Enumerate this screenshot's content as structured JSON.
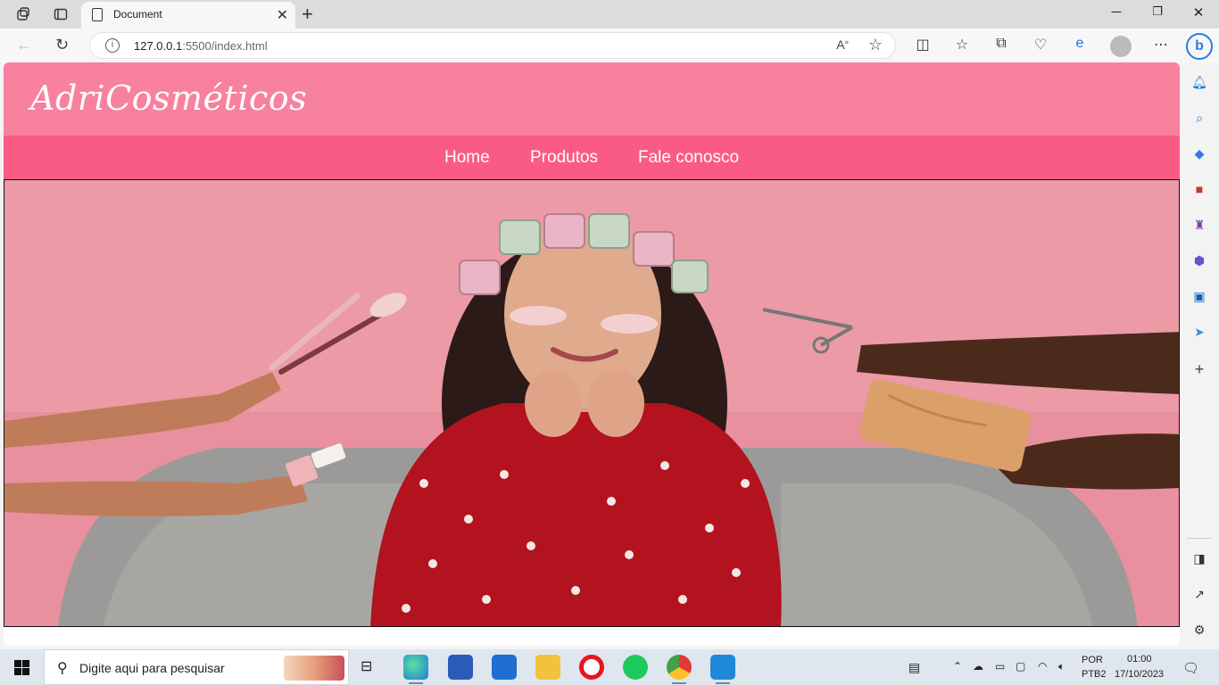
{
  "browser": {
    "tab_title": "Document",
    "url_host": "127.0.0.1",
    "url_rest": ":5500/index.html"
  },
  "site": {
    "logo": "AdriCosméticos",
    "nav": [
      "Home",
      "Produtos",
      "Fale conosco"
    ]
  },
  "taskbar": {
    "search_placeholder": "Digite aqui para pesquisar",
    "lang_top": "POR",
    "lang_bottom": "PTB2",
    "time": "01:00",
    "date": "17/10/2023"
  },
  "colors": {
    "header_pink": "#f7819e",
    "nav_pink": "#fa5b84",
    "hero_bg": "#e9929f",
    "shirt_red": "#b3121f"
  }
}
